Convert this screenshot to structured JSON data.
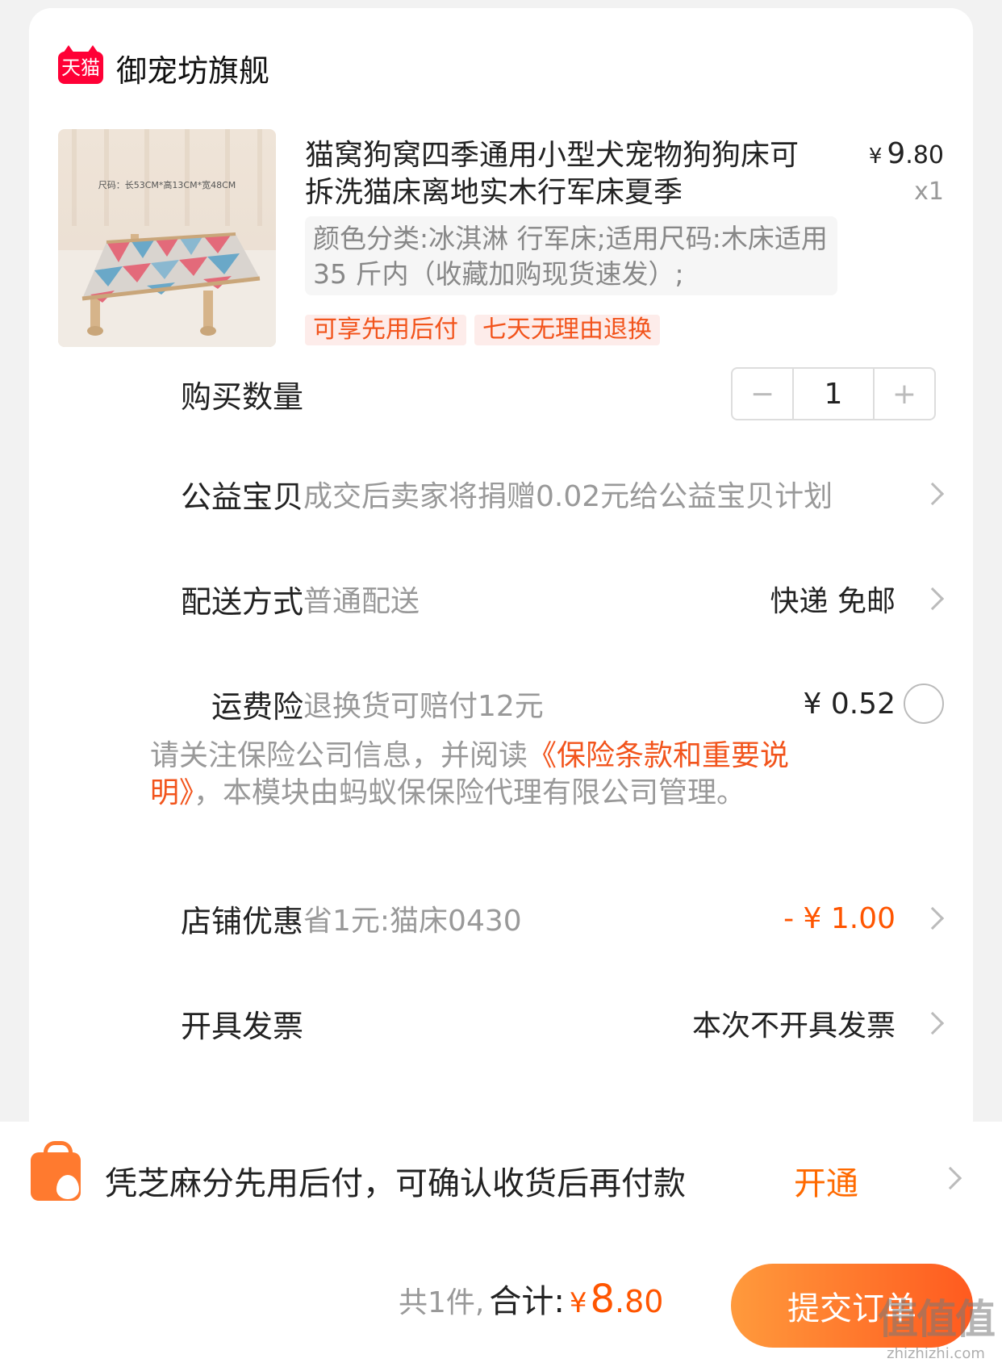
{
  "shop": {
    "logo_text": "天猫",
    "name": "御宠坊旗舰"
  },
  "product": {
    "image_caption": "尺码：长53CM*高13CM*宽48CM",
    "title": "猫窝狗窝四季通用小型犬宠物狗狗床可拆洗猫床离地实木行军床夏季",
    "price_symbol": "¥",
    "price_integer": "9",
    "price_decimal": ".80",
    "quantity_label": "x1",
    "sku": "颜色分类:冰淇淋 行军床;适用尺码:木床适用 35 斤内（收藏加购现货速发）;",
    "tags": [
      "可享先用后付",
      "七天无理由退换"
    ]
  },
  "rows": {
    "quantity": {
      "label": "购买数量",
      "value": "1",
      "minus": "−",
      "plus": "+"
    },
    "charity": {
      "label": "公益宝贝",
      "desc": "成交后卖家将捐赠0.02元给公益宝贝计划"
    },
    "delivery": {
      "label": "配送方式",
      "desc": "普通配送",
      "value": "快递 免邮"
    },
    "insurance": {
      "label": "运费险",
      "desc": "退换货可赔付12元",
      "value": "¥ 0.52"
    },
    "store_discount": {
      "label": "店铺优惠",
      "desc": "省1元:猫床0430",
      "value": "- ¥ 1.00"
    },
    "invoice": {
      "label": "开具发票",
      "value": "本次不开具发票"
    }
  },
  "notice": {
    "before": "请关注保险公司信息，并阅读",
    "link": "《保险条款和重要说明》",
    "after": "，本模块由蚂蚁保保险代理有限公司管理。"
  },
  "credit": {
    "text": "凭芝麻分先用后付，可确认收货后再付款",
    "action": "开通"
  },
  "checkout": {
    "count": "共1件,",
    "total_label": "合计:",
    "yen": "¥",
    "amount": "8",
    "cents": ".80",
    "submit": "提交订单"
  },
  "watermark": {
    "main": "值值值",
    "sub": "zhizhizhi.com"
  },
  "colors": {
    "accent": "#ff5500",
    "tag_bg": "#fdecea",
    "tmall_red": "#ff0036"
  }
}
